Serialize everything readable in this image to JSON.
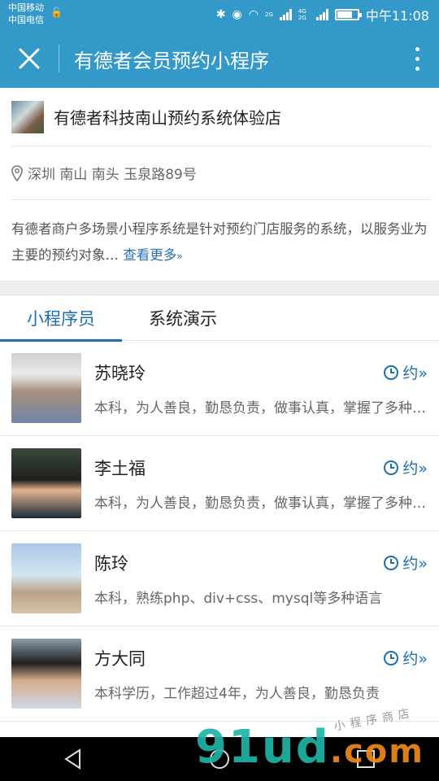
{
  "status_bar": {
    "carrier1": "中国移动",
    "carrier2": "中国电信",
    "net1": "2G",
    "net2": "4G 2G",
    "time": "中午11:08"
  },
  "title_bar": {
    "title": "有德者会员预约小程序"
  },
  "shop": {
    "name": "有德者科技南山预约系统体验店",
    "address": "深圳 南山 南头 玉泉路89号",
    "description": "有德者商户多场景小程序系统是针对预约门店服务的系统，以服务业为主要的预约对象…",
    "more_label": "查看更多"
  },
  "tabs": [
    {
      "label": "小程序员",
      "active": true
    },
    {
      "label": "系统演示",
      "active": false
    }
  ],
  "staff": [
    {
      "name": "苏晓玲",
      "book_label": "约»",
      "desc": "本科，为人善良，勤恳负责，做事认真，掌握了多种开发语言"
    },
    {
      "name": "李土福",
      "book_label": "约»",
      "desc": "本科，为人善良，勤恳负责，做事认真，掌握了多种开发语言"
    },
    {
      "name": "陈玲",
      "book_label": "约»",
      "desc": "本科，熟练php、div+css、mysql等多种语言"
    },
    {
      "name": "方大同",
      "book_label": "约»",
      "desc": "本科学历，工作超过4年，为人善良，勤恳负责"
    }
  ],
  "watermark": {
    "main": "91ud",
    "suffix": ".com",
    "sub": "小程序商店"
  },
  "colors": {
    "header": "#3399c9",
    "accent": "#1c6fae",
    "link": "#2a6fb8"
  }
}
